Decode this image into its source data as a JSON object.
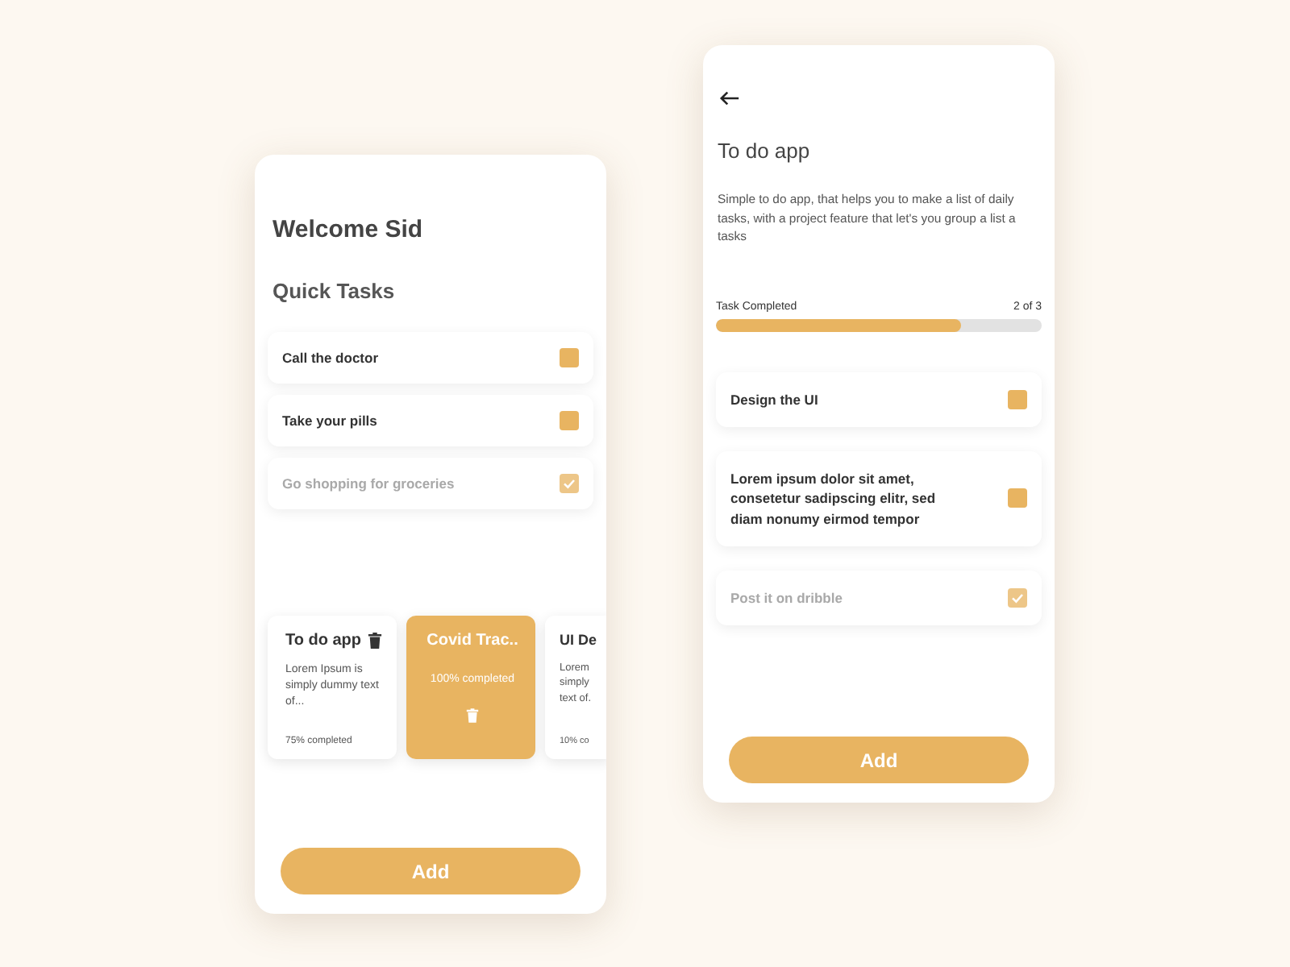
{
  "home_screen": {
    "greeting": "Welcome Sid",
    "section_title": "Quick Tasks",
    "quick_tasks": [
      {
        "label": "Call the doctor",
        "checked": false
      },
      {
        "label": "Take your pills",
        "checked": false
      },
      {
        "label": "Go shopping for groceries",
        "checked": true
      }
    ],
    "projects": [
      {
        "title": "To do app",
        "description": "Lorem Ipsum is simply dummy text of...",
        "progress": "75% completed",
        "selected": false
      },
      {
        "title": "Covid Trac..",
        "progress": "100% completed",
        "selected": true
      },
      {
        "title": "UI De",
        "description": "Lorem simply text of.",
        "progress": "10% co",
        "selected": false
      }
    ],
    "add_button": "Add"
  },
  "detail_screen": {
    "title": "To do app",
    "description": "Simple to do app, that helps you to make a list of daily tasks, with a project feature that let's you group a list a tasks",
    "progress": {
      "label": "Task Completed",
      "count": "2 of 3",
      "level": 0.75
    },
    "tasks": [
      {
        "label": "Design the UI",
        "checked": false
      },
      {
        "label": "Lorem ipsum dolor sit amet, consetetur sadipscing elitr, sed diam nonumy eirmod tempor",
        "checked": false
      },
      {
        "label": "Post it on dribble",
        "checked": true
      }
    ],
    "add_button": "Add"
  }
}
